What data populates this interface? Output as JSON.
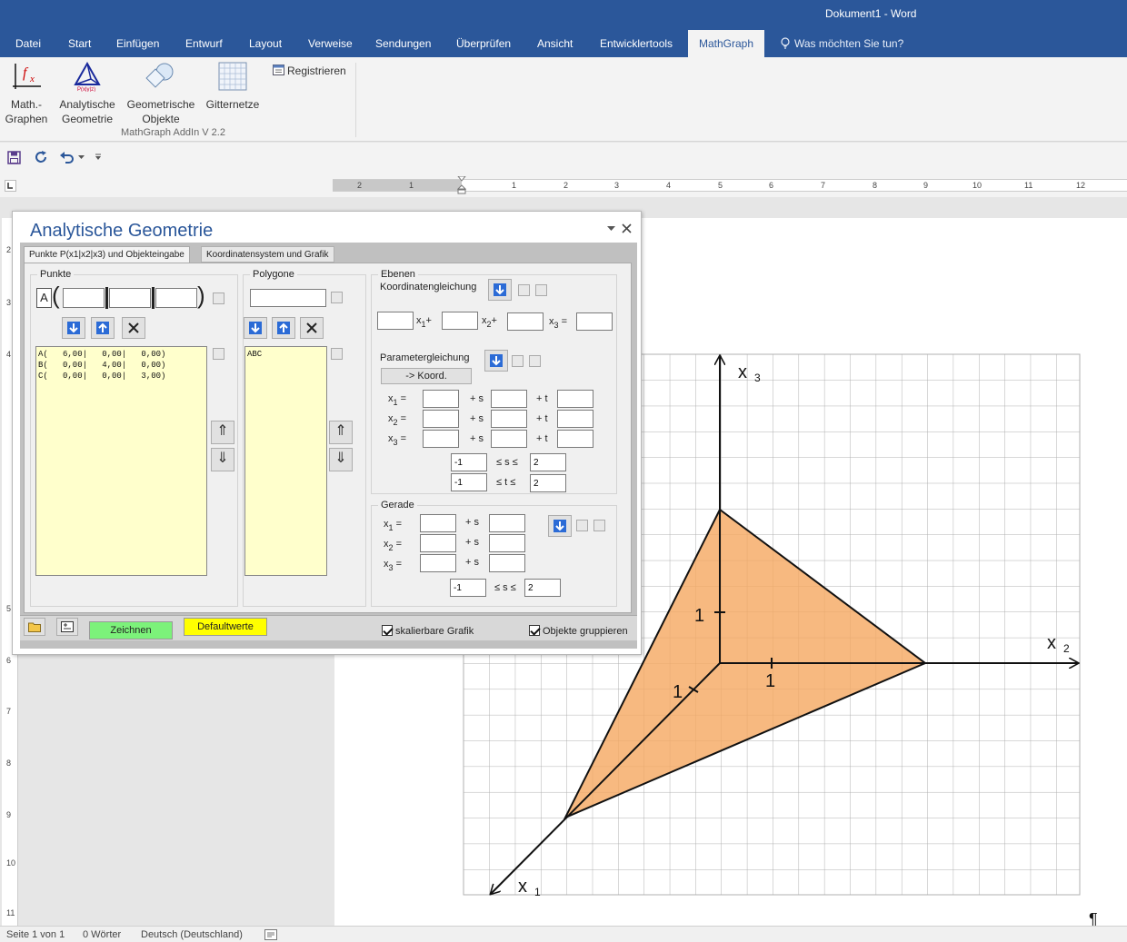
{
  "window": {
    "title": "Dokument1 - Word"
  },
  "tabs": [
    "Datei",
    "Start",
    "Einfügen",
    "Entwurf",
    "Layout",
    "Verweise",
    "Sendungen",
    "Überprüfen",
    "Ansicht",
    "Entwicklertools",
    "MathGraph"
  ],
  "tellme": "Was möchten Sie tun?",
  "ribbon": {
    "buttons": [
      {
        "line1": "Math.-",
        "line2": "Graphen"
      },
      {
        "line1": "Analytische",
        "line2": "Geometrie"
      },
      {
        "line1": "Geometrische",
        "line2": "Objekte"
      },
      {
        "line1": "Gitternetze",
        "line2": ""
      }
    ],
    "register_label": "Registrieren",
    "group_name": "MathGraph AddIn  V 2.2"
  },
  "ruler": {
    "numbers": [
      "2",
      "1",
      "1",
      "2",
      "3",
      "4",
      "5",
      "6",
      "7",
      "8",
      "9",
      "10",
      "11",
      "12"
    ]
  },
  "vruler": {
    "numbers": [
      "2",
      "3",
      "4",
      "5",
      "6",
      "7",
      "8",
      "9",
      "10",
      "11"
    ]
  },
  "status": {
    "page": "Seite 1 von 1",
    "words": "0 Wörter",
    "language": "Deutsch (Deutschland)"
  },
  "dialog": {
    "title": "Analytische Geometrie",
    "tab_active": "Punkte P(x1|x2|x3)  und  Objekteingabe",
    "tab_inactive": "Koordinatensystem und Grafik",
    "punkte": {
      "label": "Punkte",
      "point_name": "A",
      "list": "A(   6,00|   0,00|   0,00)\nB(   0,00|   4,00|   0,00)\nC(   0,00|   0,00|   3,00)"
    },
    "polygone": {
      "label": "Polygone",
      "list": "ABC"
    },
    "ebenen": {
      "label": "Ebenen",
      "koord_label": "Koordinatengleichung",
      "param_label": "Parametergleichung",
      "koord_button": "-> Koord.",
      "s_min": "-1",
      "s_max": "2",
      "t_min": "-1",
      "t_max": "2",
      "s_range": "≤ s ≤",
      "t_range": "≤ t ≤"
    },
    "gerade": {
      "label": "Gerade",
      "s_min": "-1",
      "s_max": "2",
      "s_range": "≤ s ≤"
    },
    "footer": {
      "zeichnen": "Zeichnen",
      "defaultwerte": "Defaultwerte",
      "skalierbar": "skalierbare Grafik",
      "gruppieren": "Objekte gruppieren"
    }
  },
  "graph": {
    "axis_x1": "x",
    "axis_x1_sub": "1",
    "axis_x2": "x",
    "axis_x2_sub": "2",
    "axis_x3": "x",
    "axis_x3_sub": "3",
    "tick_label": "1",
    "fill_color": "#f5a860",
    "pilcrow": "¶"
  }
}
